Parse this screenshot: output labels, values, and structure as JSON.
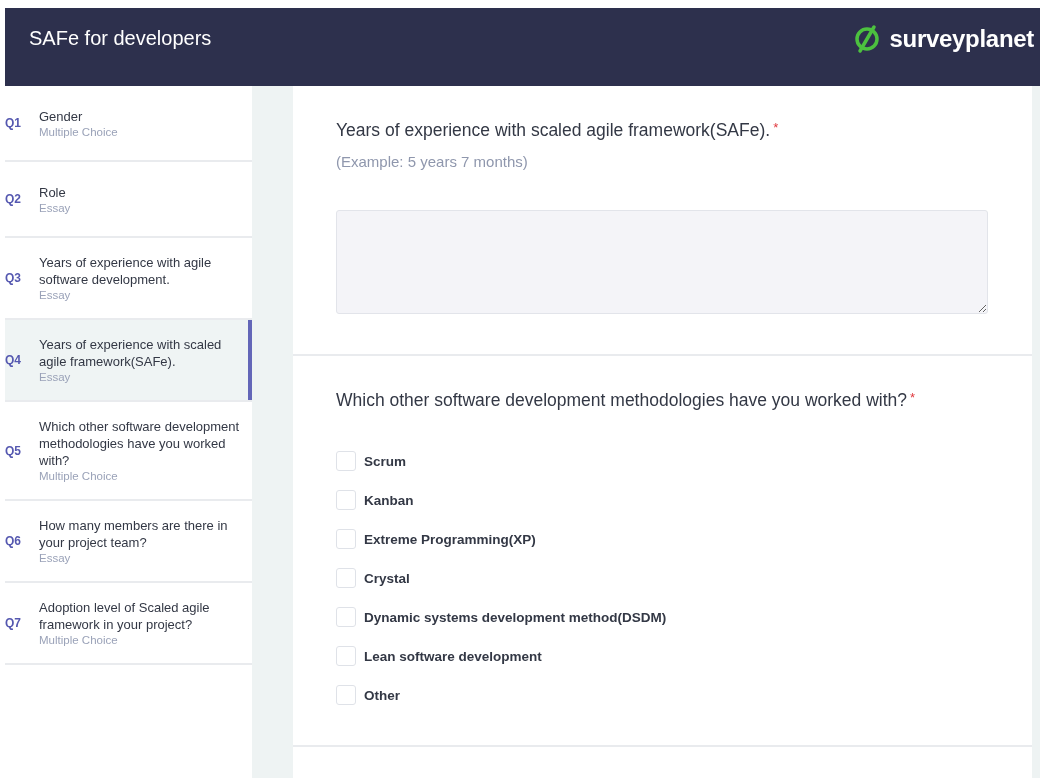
{
  "header": {
    "title": "SAFe for developers",
    "logo_text": "surveyplanet"
  },
  "sidebar": {
    "items": [
      {
        "number": "Q1",
        "title": "Gender",
        "type": "Multiple Choice",
        "selected": false
      },
      {
        "number": "Q2",
        "title": "Role",
        "type": "Essay",
        "selected": false
      },
      {
        "number": "Q3",
        "title": "Years of experience with agile software development.",
        "type": "Essay",
        "selected": false
      },
      {
        "number": "Q4",
        "title": "Years of experience with scaled agile framework(SAFe).",
        "type": "Essay",
        "selected": true
      },
      {
        "number": "Q5",
        "title": "Which other software development methodologies have you worked with?",
        "type": "Multiple Choice",
        "selected": false
      },
      {
        "number": "Q6",
        "title": "How many members are there in your project team?",
        "type": "Essay",
        "selected": false
      },
      {
        "number": "Q7",
        "title": "Adoption level of Scaled agile framework in your project?",
        "type": "Multiple Choice",
        "selected": false
      }
    ]
  },
  "questions": [
    {
      "kind": "essay",
      "title": "Years of experience with scaled agile framework(SAFe).",
      "required_mark": "*",
      "hint": "(Example: 5 years 7 months)"
    },
    {
      "kind": "checkboxes",
      "title": "Which other software development methodologies have you worked with?",
      "required_mark": "*",
      "options": [
        {
          "label": "Scrum",
          "checked": false
        },
        {
          "label": "Kanban",
          "checked": false
        },
        {
          "label": "Extreme Programming(XP)",
          "checked": false
        },
        {
          "label": "Crystal",
          "checked": false
        },
        {
          "label": "Dynamic systems development method(DSDM)",
          "checked": false
        },
        {
          "label": "Lean software development",
          "checked": false
        },
        {
          "label": "Other",
          "checked": false
        }
      ]
    }
  ]
}
